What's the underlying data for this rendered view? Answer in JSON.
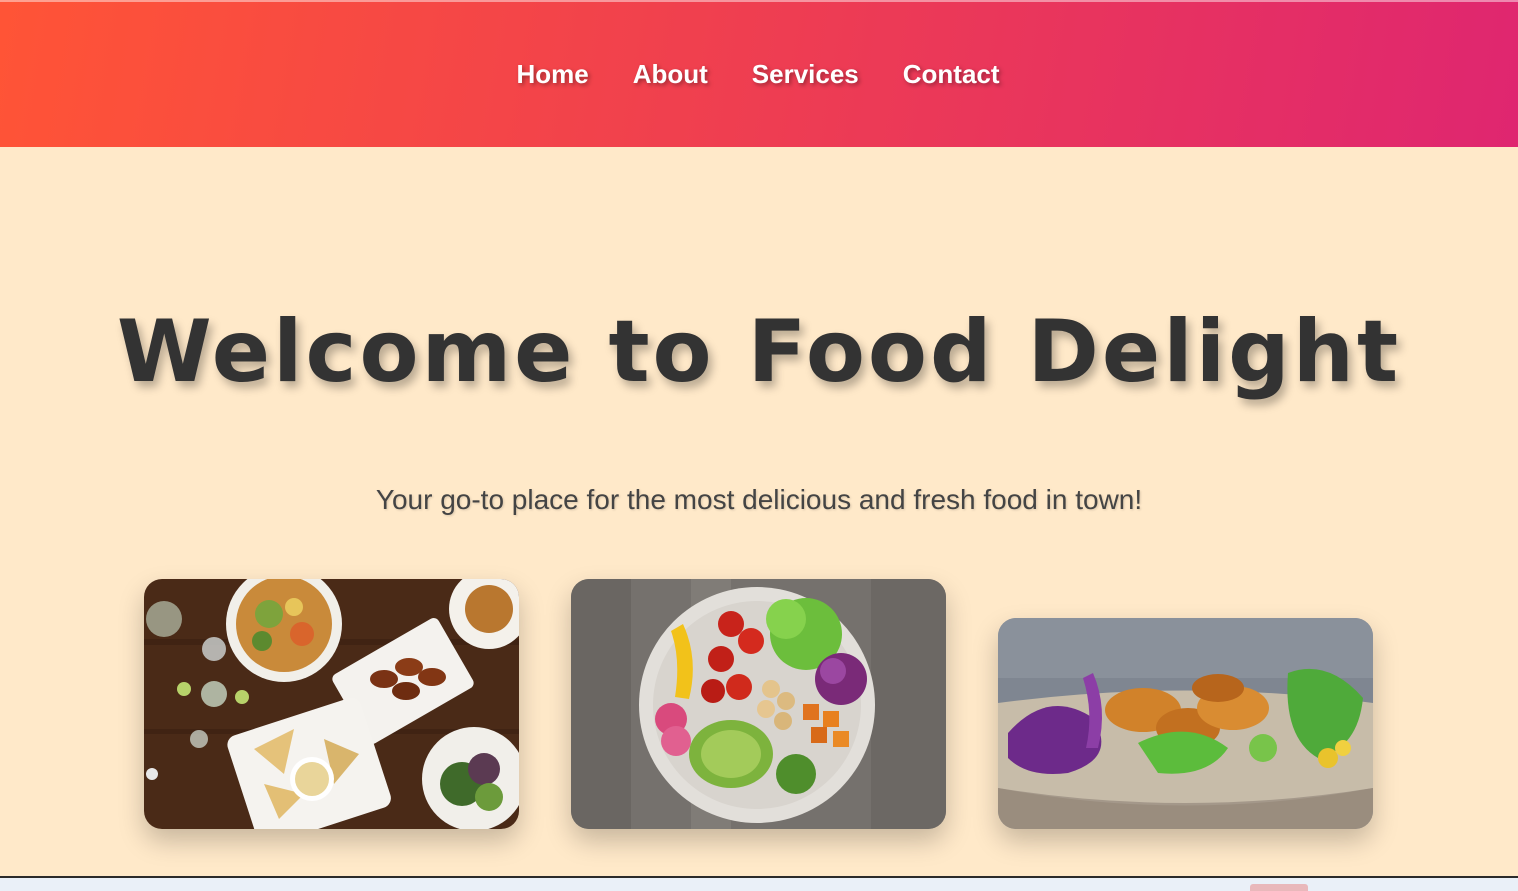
{
  "nav": {
    "items": [
      {
        "label": "Home"
      },
      {
        "label": "About"
      },
      {
        "label": "Services"
      },
      {
        "label": "Contact"
      }
    ]
  },
  "hero": {
    "title": "Welcome to Food Delight",
    "subtitle": "Your go-to place for the most delicious and fresh food in town!"
  },
  "gallery": {
    "images": [
      {
        "subject": "table-spread-photo"
      },
      {
        "subject": "veggie-bowl-photo"
      },
      {
        "subject": "chicken-salad-photo"
      }
    ]
  },
  "colors": {
    "nav_gradient_start": "#ff5436",
    "nav_gradient_end": "#df2670",
    "background": "#ffe9c9",
    "title": "#333333"
  }
}
